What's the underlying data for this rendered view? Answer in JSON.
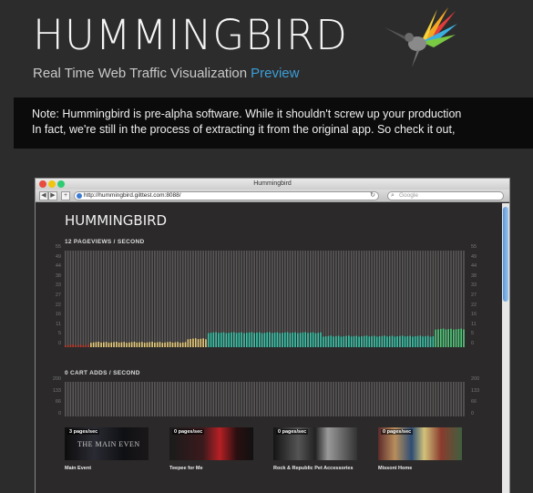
{
  "header": {
    "title": "HUMMINGBIRD",
    "tagline": "Real Time Web Traffic Visualization",
    "preview_link": "Preview",
    "logo_icon": "hummingbird-logo-icon"
  },
  "note": {
    "line1": "Note: Hummingbird is pre-alpha software. While it shouldn't screw up your production",
    "line2": "In fact, we're still in the process of extracting it from the original app. So check it out,"
  },
  "browser": {
    "window_title": "Hummingbird",
    "url": "http://hummingbird.gilttest.com:8088/",
    "search_placeholder": "Google",
    "back_icon": "back-arrow-icon",
    "forward_icon": "forward-arrow-icon",
    "add_icon": "plus-icon",
    "reload_icon": "reload-icon"
  },
  "app": {
    "title": "HUMMINGBIRD",
    "pageviews": {
      "label": "12 PAGEVIEWS / SECOND",
      "ticks": [
        "55",
        "49",
        "44",
        "38",
        "33",
        "27",
        "22",
        "16",
        "11",
        "5",
        "0"
      ],
      "segments": [
        {
          "count": 10,
          "value": 1,
          "color": "#c0392b"
        },
        {
          "count": 38,
          "value": 2.5,
          "color": "#e8cd7a"
        },
        {
          "count": 8,
          "value": 4.5,
          "color": "#e8cd7a"
        },
        {
          "count": 45,
          "value": 8,
          "color": "#38c7ab"
        },
        {
          "count": 44,
          "value": 6,
          "color": "#38c7ab"
        },
        {
          "count": 12,
          "value": 10,
          "color": "#4ecb7a"
        }
      ]
    },
    "cart_adds": {
      "label": "0 CART ADDS / SECOND",
      "ticks": [
        "200",
        "133",
        "66",
        "0"
      ]
    },
    "products": [
      {
        "pps": "3 pages/sec",
        "name": "Main Event",
        "overlay": "THE MAIN EVEN"
      },
      {
        "pps": "0 pages/sec",
        "name": "Teepee for Me",
        "overlay": ""
      },
      {
        "pps": "0 pages/sec",
        "name": "Rock & Republic Pet Accessories",
        "overlay": ""
      },
      {
        "pps": "0 pages/sec",
        "name": "Missoni Home",
        "overlay": ""
      }
    ]
  },
  "colors": {
    "accent": "#3a9ed8",
    "background": "#2d2c2c",
    "note_bg": "#0b0b0b",
    "teal": "#38c7ab",
    "gold": "#e8cd7a",
    "green": "#4ecb7a"
  }
}
